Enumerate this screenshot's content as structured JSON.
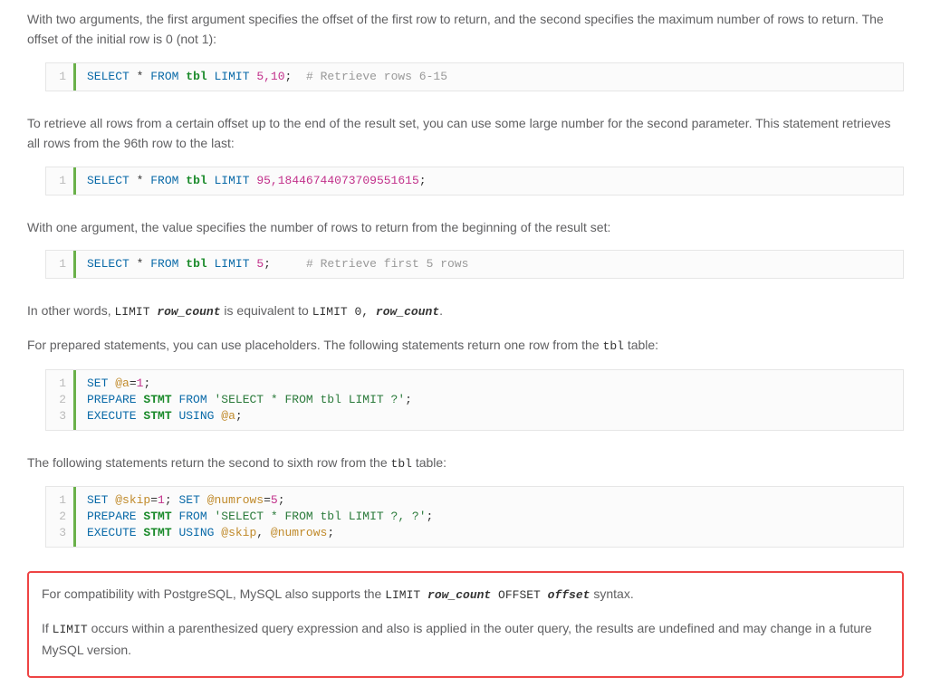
{
  "para1": "With two arguments, the first argument specifies the offset of the first row to return, and the second specifies the maximum number of rows to return. The offset of the initial row is 0 (not 1):",
  "cb1": {
    "gutter": [
      "1"
    ],
    "kw1": "SELECT",
    "star": "*",
    "kw2": "FROM",
    "tbl": "tbl",
    "kw3": "LIMIT",
    "num": "5,10",
    "semi": ";",
    "cmt": "# Retrieve rows 6-15"
  },
  "para2": "To retrieve all rows from a certain offset up to the end of the result set, you can use some large number for the second parameter. This statement retrieves all rows from the 96th row to the last:",
  "cb2": {
    "gutter": [
      "1"
    ],
    "kw1": "SELECT",
    "star": "*",
    "kw2": "FROM",
    "tbl": "tbl",
    "kw3": "LIMIT",
    "num": "95,18446744073709551615",
    "semi": ";"
  },
  "para3": "With one argument, the value specifies the number of rows to return from the beginning of the result set:",
  "cb3": {
    "gutter": [
      "1"
    ],
    "kw1": "SELECT",
    "star": "*",
    "kw2": "FROM",
    "tbl": "tbl",
    "kw3": "LIMIT",
    "num": "5",
    "semi": ";",
    "cmt": "# Retrieve first 5 rows"
  },
  "para4": {
    "pre": "In other words, ",
    "c1": "LIMIT ",
    "i1": "row_count",
    "mid": " is equivalent to ",
    "c2": "LIMIT 0, ",
    "i2": "row_count",
    "post": "."
  },
  "para5": {
    "pre": "For prepared statements, you can use placeholders. The following statements return one row from the ",
    "c": "tbl",
    "post": " table:"
  },
  "cb4": {
    "gutter": [
      "1",
      "2",
      "3"
    ],
    "l1": {
      "kw": "SET",
      "var": "@a",
      "eq": "=",
      "num": "1",
      "semi": ";"
    },
    "l2": {
      "kw1": "PREPARE",
      "name": "STMT",
      "kw2": "FROM",
      "str": "'SELECT * FROM tbl LIMIT ?'",
      "semi": ";"
    },
    "l3": {
      "kw1": "EXECUTE",
      "name": "STMT",
      "kw2": "USING",
      "var": "@a",
      "semi": ";"
    }
  },
  "para6": {
    "pre": "The following statements return the second to sixth row from the ",
    "c": "tbl",
    "post": " table:"
  },
  "cb5": {
    "gutter": [
      "1",
      "2",
      "3"
    ],
    "l1": {
      "kwa": "SET",
      "var1": "@skip",
      "eq": "=",
      "n1": "1",
      "sc1": "; ",
      "kwb": "SET",
      "var2": "@numrows",
      "n2": "5",
      "sc2": ";"
    },
    "l2": {
      "kw1": "PREPARE",
      "name": "STMT",
      "kw2": "FROM",
      "str": "'SELECT * FROM tbl LIMIT ?, ?'",
      "semi": ";"
    },
    "l3": {
      "kw1": "EXECUTE",
      "name": "STMT",
      "kw2": "USING",
      "var1": "@skip",
      "comma": ", ",
      "var2": "@numrows",
      "semi": ";"
    }
  },
  "callout": {
    "p1": {
      "pre": "For compatibility with PostgreSQL, MySQL also supports the ",
      "c1": "LIMIT ",
      "i1": "row_count",
      "c2": " OFFSET ",
      "i2": "offset",
      "post": " syntax."
    },
    "p2": {
      "pre": "If ",
      "c": "LIMIT",
      "post": " occurs within a parenthesized query expression and also is applied in the outer query, the results are undefined and may change in a future MySQL version."
    }
  }
}
